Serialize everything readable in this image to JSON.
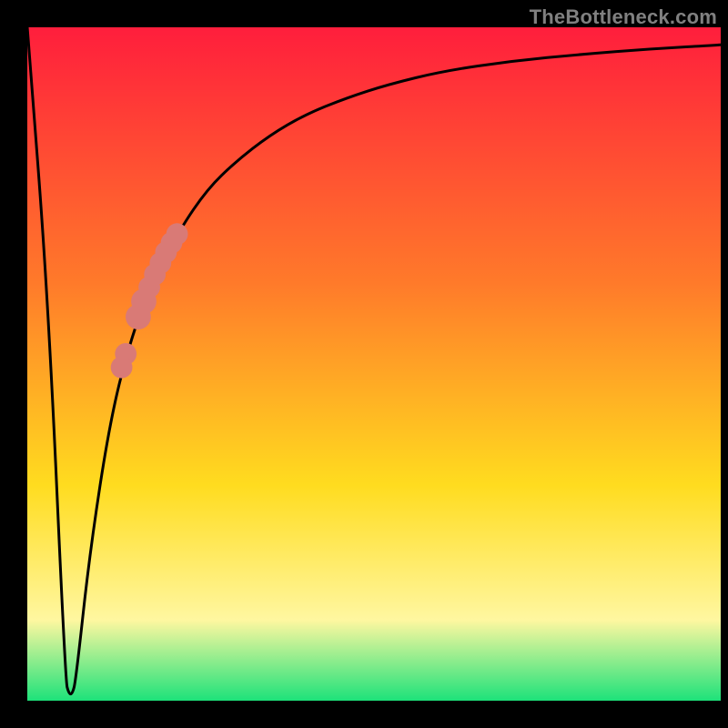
{
  "watermark": "TheBottleneck.com",
  "colors": {
    "gradient_top": "#ff1e3c",
    "gradient_mid1": "#ff7a2a",
    "gradient_mid2": "#ffdc1f",
    "gradient_mid3": "#fff7a0",
    "gradient_bottom": "#1de27a",
    "curve": "#000000",
    "markers": "#d97a76",
    "frame": "#000000"
  },
  "chart_data": {
    "type": "line",
    "title": "",
    "xlabel": "",
    "ylabel": "",
    "xlim": [
      0,
      100
    ],
    "ylim": [
      0,
      100
    ],
    "series": [
      {
        "name": "bottleneck-curve",
        "x": [
          0,
          3,
          5.5,
          6,
          6.5,
          7,
          9,
          12,
          15,
          18,
          22,
          26,
          30,
          35,
          40,
          46,
          52,
          60,
          70,
          80,
          90,
          100
        ],
        "values": [
          100,
          60,
          3,
          1,
          1,
          3,
          22,
          42,
          54,
          62,
          70,
          76,
          80,
          84,
          87,
          89.5,
          91.5,
          93.5,
          95,
          96,
          96.8,
          97.4
        ]
      }
    ],
    "markers": [
      {
        "x": 16.0,
        "y": 57.0,
        "r": 1.4
      },
      {
        "x": 16.8,
        "y": 59.3,
        "r": 1.4
      },
      {
        "x": 17.6,
        "y": 61.4,
        "r": 1.2
      },
      {
        "x": 18.4,
        "y": 63.3,
        "r": 1.2
      },
      {
        "x": 19.2,
        "y": 65.0,
        "r": 1.2
      },
      {
        "x": 20.0,
        "y": 66.6,
        "r": 1.2
      },
      {
        "x": 20.8,
        "y": 68.0,
        "r": 1.2
      },
      {
        "x": 21.6,
        "y": 69.3,
        "r": 1.2
      },
      {
        "x": 14.2,
        "y": 51.5,
        "r": 1.2
      },
      {
        "x": 13.6,
        "y": 49.5,
        "r": 1.2
      }
    ]
  }
}
